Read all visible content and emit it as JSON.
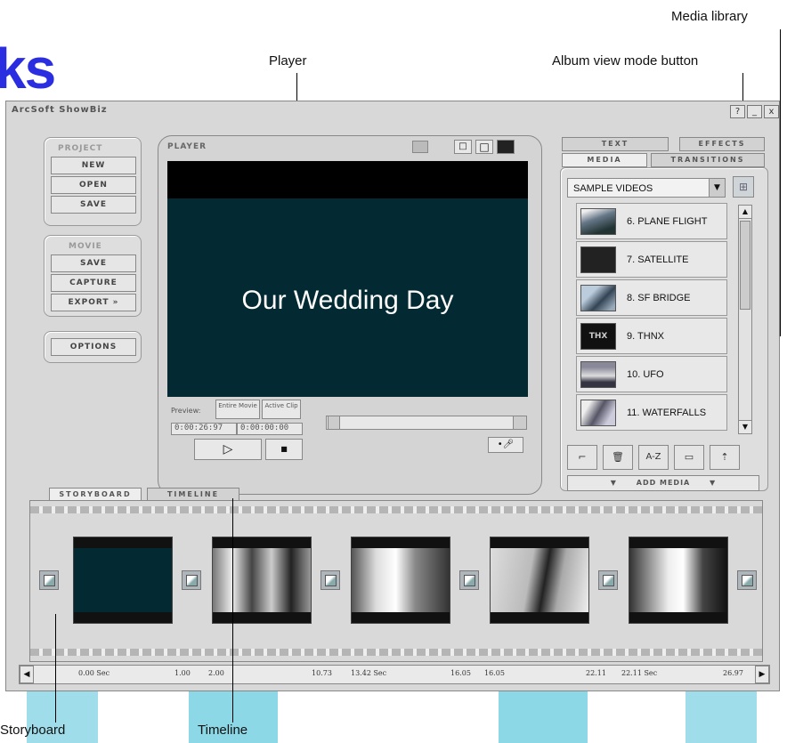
{
  "watermark": {
    "text": "ks"
  },
  "callouts": {
    "media_library": "Media library",
    "player": "Player",
    "album_view_mode": "Album view mode button",
    "storyboard": "Storyboard",
    "timeline": "Timeline"
  },
  "window": {
    "title": "ArcSoft ShowBiz",
    "controls": [
      "?",
      "_",
      "x"
    ]
  },
  "project": {
    "heading": "Project",
    "buttons": [
      "New",
      "Open",
      "Save"
    ]
  },
  "movie": {
    "heading": "Movie",
    "buttons": [
      "Save",
      "Capture",
      "Export »"
    ]
  },
  "options_label": "Options",
  "player": {
    "label": "Player",
    "screen_text": "Our Wedding Day",
    "preview_label": "Preview:",
    "preview_modes": [
      "Entire Movie",
      "Active Clip"
    ],
    "time_total": "0:00:26:97",
    "time_current": "0:00:00:00",
    "play_symbol": "▷",
    "stop_symbol": "■"
  },
  "tabs": {
    "text": "Text",
    "effects": "Effects",
    "media": "Media",
    "transitions": "Transitions"
  },
  "media": {
    "selected_folder": "SAMPLE VIDEOS",
    "items": [
      {
        "label": "6. PLANE FLIGHT"
      },
      {
        "label": "7. SATELLITE"
      },
      {
        "label": "8. SF BRIDGE"
      },
      {
        "label": "9. THNX",
        "thumb_text": "THX"
      },
      {
        "label": "10. UFO"
      },
      {
        "label": "11. WATERFALLS"
      }
    ],
    "add_media_label": "Add Media",
    "toolbar": {
      "sort_label": "A-Z"
    }
  },
  "storyboard_tabs": {
    "storyboard": "Storyboard",
    "timeline": "Timeline"
  },
  "timeline_ticks": [
    "0.00 Sec",
    "1.00",
    "2.00",
    "10.73",
    "13.42 Sec",
    "16.05",
    "16.05",
    "22.11",
    "22.11 Sec",
    "26.97"
  ],
  "colors": {
    "screen": "#032a33",
    "panel": "#d8d8d8",
    "watermark_accent": "#4fc3d8",
    "logo_blue": "#2a2ee0"
  }
}
